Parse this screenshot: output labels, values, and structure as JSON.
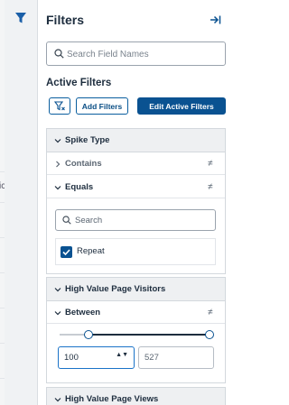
{
  "colors": {
    "brand": "#0a5291",
    "border": "#d3d8dd",
    "group_header_bg": "#eef0f2"
  },
  "rail": {
    "icon": "filter-icon",
    "glyph": "ic"
  },
  "panel": {
    "title": "Filters",
    "collapse_icon": "collapse-panel-icon",
    "search": {
      "placeholder": "Search Field Names",
      "value": ""
    },
    "active_filters_title": "Active Filters",
    "buttons": {
      "clear_icon": "clear-filter-icon",
      "add_label": "Add Filters",
      "edit_label": "Edit Active Filters"
    },
    "groups": [
      {
        "label": "Spike Type",
        "expanded": true,
        "rows": [
          {
            "label": "Contains",
            "operator": "≠",
            "expanded": false
          },
          {
            "label": "Equals",
            "operator": "≠",
            "expanded": true
          }
        ],
        "value_search": {
          "placeholder": "Search",
          "value": ""
        },
        "options": [
          {
            "label": "Repeat",
            "checked": true
          }
        ]
      },
      {
        "label": "High Value Page Visitors",
        "expanded": true,
        "rows": [
          {
            "label": "Between",
            "operator": "≠",
            "expanded": true
          }
        ],
        "range": {
          "min": "100",
          "max": "527",
          "spin": "▲▼"
        }
      },
      {
        "label": "High Value Page Views",
        "expanded": true
      }
    ]
  }
}
